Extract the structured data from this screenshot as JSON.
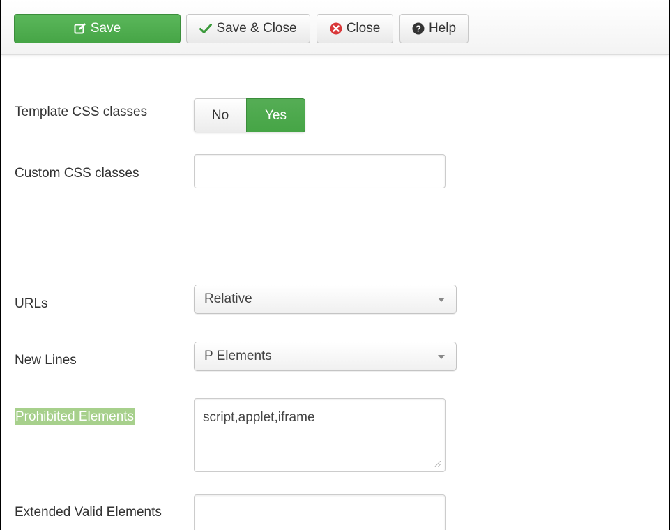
{
  "toolbar": {
    "save_label": "Save",
    "save_icon": "edit-icon",
    "save_close_label": "Save & Close",
    "save_close_icon": "checkmark-icon",
    "close_label": "Close",
    "close_icon": "close-circle-icon",
    "help_label": "Help",
    "help_icon": "help-circle-icon"
  },
  "form": {
    "template_css": {
      "label": "Template CSS classes",
      "no_label": "No",
      "yes_label": "Yes",
      "selected": "Yes"
    },
    "custom_css": {
      "label": "Custom CSS classes",
      "value": ""
    },
    "urls": {
      "label": "URLs",
      "selected": "Relative"
    },
    "new_lines": {
      "label": "New Lines",
      "selected": "P Elements"
    },
    "prohibited_elements": {
      "label": "Prohibited Elements",
      "value": "script,applet,iframe"
    },
    "extended_valid_elements": {
      "label": "Extended Valid Elements",
      "value": ""
    }
  },
  "colors": {
    "success_green": "#46a546",
    "label_highlight": "#a7d08c",
    "close_red": "#d9383a"
  }
}
